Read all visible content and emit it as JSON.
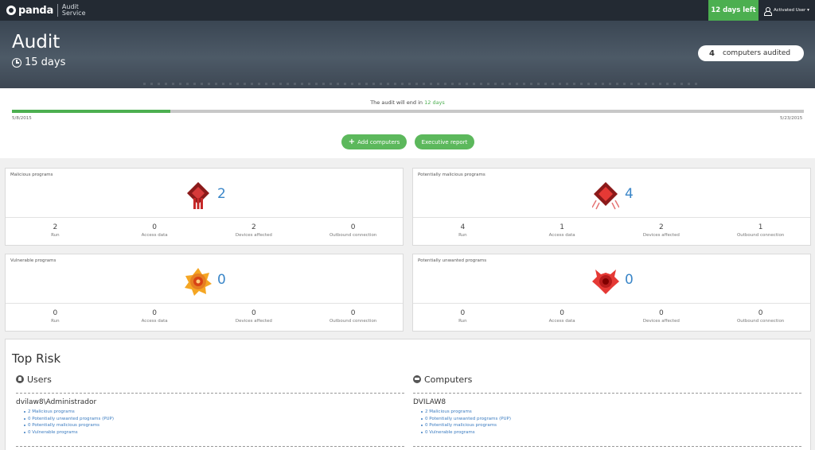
{
  "topbar": {
    "logo": "panda",
    "product_line1": "Audit",
    "product_line2": "Service",
    "days_left": "12 days left",
    "user": "Activated User ▾"
  },
  "hero": {
    "title": "Audit",
    "duration": "15 days",
    "computers_count": "4",
    "computers_label": "computers audited"
  },
  "progress": {
    "text_prefix": "The audit will end in ",
    "text_highlight": "12 days",
    "fraction_elapsed": 0.2,
    "start_date": "5/8/2015",
    "end_date": "5/23/2015"
  },
  "actions": {
    "add_computers": "Add computers",
    "executive_report": "Executive report"
  },
  "colors": {
    "accent_green": "#4caf50",
    "count_blue": "#3a86c8",
    "link_blue": "#3a7bc0"
  },
  "cards": {
    "malicious": {
      "title": "Malicious programs",
      "icon": "malware-icon",
      "count": "2",
      "stats": [
        {
          "value": "2",
          "label": "Run"
        },
        {
          "value": "0",
          "label": "Access data"
        },
        {
          "value": "2",
          "label": "Devices affected"
        },
        {
          "value": "0",
          "label": "Outbound connection"
        }
      ]
    },
    "potentially_malicious": {
      "title": "Potentially malicious programs",
      "icon": "potential-malware-icon",
      "count": "4",
      "stats": [
        {
          "value": "4",
          "label": "Run"
        },
        {
          "value": "1",
          "label": "Access data"
        },
        {
          "value": "2",
          "label": "Devices affected"
        },
        {
          "value": "1",
          "label": "Outbound connection"
        }
      ]
    },
    "vulnerable": {
      "title": "Vulnerable programs",
      "icon": "vulnerable-icon",
      "count": "0",
      "stats": [
        {
          "value": "0",
          "label": "Run"
        },
        {
          "value": "0",
          "label": "Access data"
        },
        {
          "value": "0",
          "label": "Devices affected"
        },
        {
          "value": "0",
          "label": "Outbound connection"
        }
      ]
    },
    "pup": {
      "title": "Potentially unwanted programs",
      "icon": "pup-icon",
      "count": "0",
      "stats": [
        {
          "value": "0",
          "label": "Run"
        },
        {
          "value": "0",
          "label": "Access data"
        },
        {
          "value": "0",
          "label": "Devices affected"
        },
        {
          "value": "0",
          "label": "Outbound connection"
        }
      ]
    }
  },
  "top_risk": {
    "title": "Top Risk",
    "users": {
      "heading": "Users",
      "entity": "dvilaw8\\Administrador",
      "items": [
        "2 Malicious programs",
        "0 Potentially unwanted programs (PUP)",
        "0 Potentially malicious programs",
        "0 Vulnerable programs"
      ]
    },
    "computers": {
      "heading": "Computers",
      "entity": "DVILAW8",
      "items": [
        "2 Malicious programs",
        "0 Potentially unwanted programs (PUP)",
        "0 Potentially malicious programs",
        "0 Vulnerable programs"
      ]
    }
  }
}
